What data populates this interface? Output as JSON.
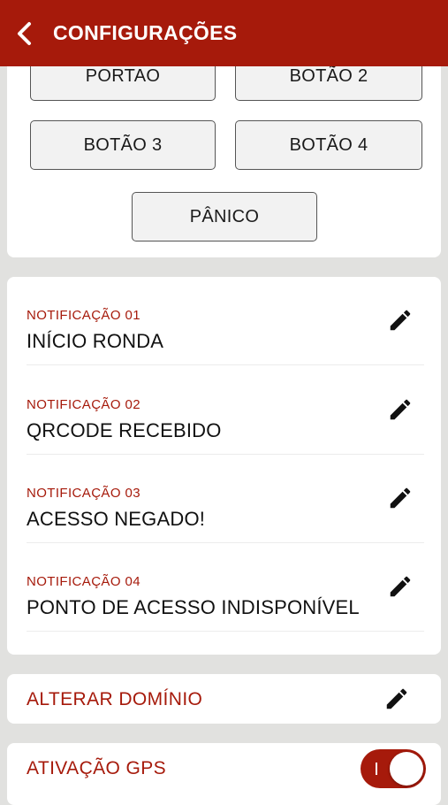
{
  "header": {
    "title": "CONFIGURAÇÕES",
    "back_icon": "chevron-left-icon",
    "color": "#a61a0b"
  },
  "buttons": [
    "PORTAO",
    "BOTÃO 2",
    "BOTÃO 3",
    "BOTÃO 4",
    "PÂNICO"
  ],
  "notifications": [
    {
      "label": "NOTIFICAÇÃO 01",
      "value": "INÍCIO RONDA"
    },
    {
      "label": "NOTIFICAÇÃO 02",
      "value": "QRCODE RECEBIDO"
    },
    {
      "label": "NOTIFICAÇÃO 03",
      "value": "ACESSO NEGADO!"
    },
    {
      "label": "NOTIFICAÇÃO 04",
      "value": "PONTO DE ACESSO INDISPONÍVEL"
    }
  ],
  "domain": {
    "label": "ALTERAR DOMÍNIO",
    "icon": "pencil-icon"
  },
  "gps": {
    "label": "ATIVAÇÃO GPS",
    "enabled": true
  },
  "accent_color": "#a61a0b"
}
